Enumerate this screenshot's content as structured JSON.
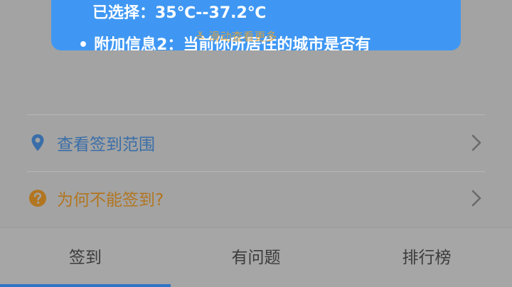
{
  "popup": {
    "selected_text": "已选择：35℃--37.2℃",
    "bullet": "•",
    "extra_info": "附加信息2：当前你所居住的城市是否有",
    "more_hint": "≚ 滑动查看更多"
  },
  "rows": [
    {
      "label": "查看签到范围",
      "icon": "location-pin-icon"
    },
    {
      "label": "为何不能签到?",
      "icon": "question-circle-icon"
    }
  ],
  "tabs": [
    {
      "label": "签到",
      "active": true
    },
    {
      "label": "有问题",
      "active": false
    },
    {
      "label": "排行榜",
      "active": false
    }
  ],
  "colors": {
    "overlay": "#a3a3a3",
    "popup_blue": "#3f97f3",
    "range_blue": "#3a6ea8",
    "warn_orange": "#b27620",
    "active_indicator": "#2f74c6"
  }
}
